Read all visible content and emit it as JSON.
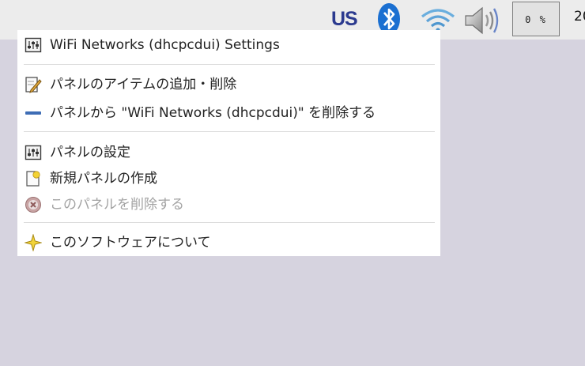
{
  "panel": {
    "keyboard_layout": "US",
    "cpu_usage": "0 %",
    "clock_partial": "20"
  },
  "menu": {
    "items": [
      {
        "label": "WiFi Networks (dhcpcdui) Settings",
        "icon": "settings-icon"
      },
      {
        "label": "パネルのアイテムの追加・削除",
        "icon": "edit-icon"
      },
      {
        "label": "パネルから \"WiFi Networks (dhcpcdui)\" を削除する",
        "icon": "remove-icon"
      },
      {
        "label": "パネルの設定",
        "icon": "settings-icon"
      },
      {
        "label": "新規パネルの作成",
        "icon": "new-document-icon"
      },
      {
        "label": "このパネルを削除する",
        "icon": "delete-icon",
        "disabled": true
      },
      {
        "label": "このソフトウェアについて",
        "icon": "about-star-icon"
      }
    ]
  },
  "colors": {
    "desktop_bg": "#d6d3df",
    "panel_bg": "#ececec",
    "keyboard_text": "#2b3a8f",
    "bluetooth": "#1a6fd1",
    "wifi": "#5ea3d8"
  }
}
